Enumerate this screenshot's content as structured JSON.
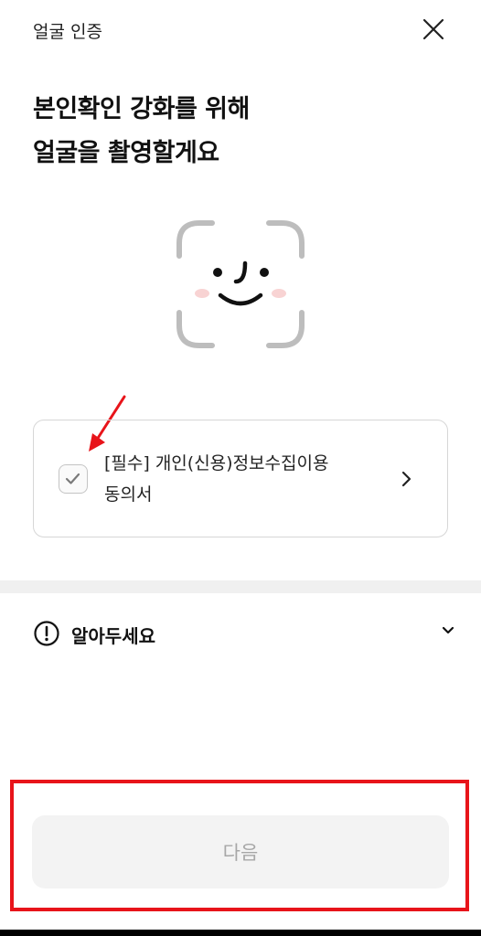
{
  "header": {
    "title": "얼굴 인증",
    "close_icon": "close-icon"
  },
  "headline": {
    "line1": "본인확인 강화를 위해",
    "line2": "얼굴을 촬영할게요"
  },
  "face_illustration": {
    "icon": "face-scan-icon"
  },
  "consent": {
    "line1": "[필수] 개인(신용)정보수집이용",
    "line2": "동의서",
    "checked": true,
    "check_icon": "check-icon",
    "chevron_icon": "chevron-right-icon"
  },
  "notice": {
    "label": "알아두세요",
    "icon": "info-circle-icon",
    "chevron_icon": "chevron-down-icon"
  },
  "next_button": {
    "label": "다음",
    "enabled": false
  },
  "colors": {
    "annotation_red": "#e8141a",
    "face_blush": "#f8d3d3",
    "button_bg": "#f3f3f3",
    "button_text": "#a7a7a7"
  }
}
